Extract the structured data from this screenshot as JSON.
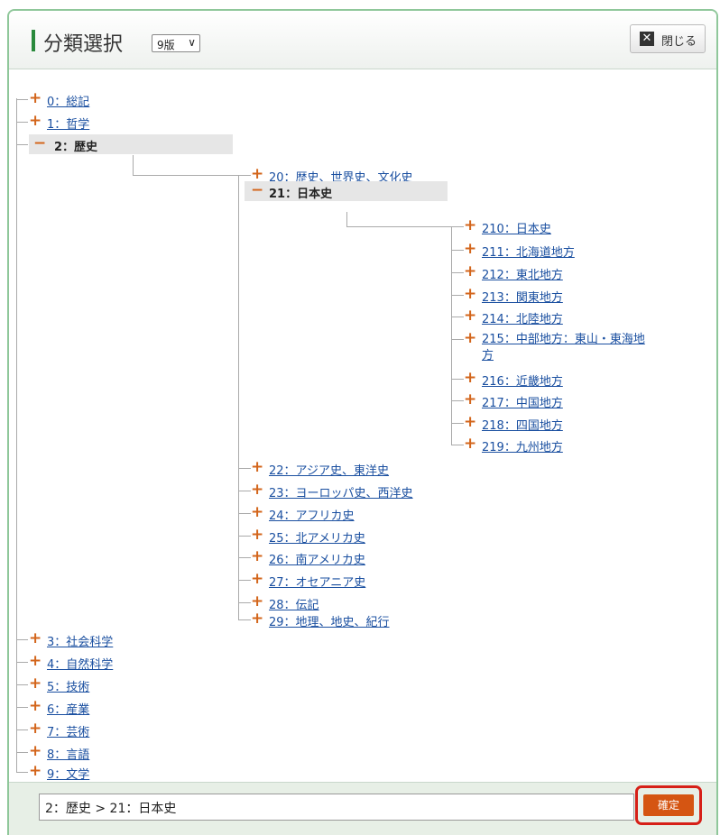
{
  "header": {
    "title": "分類選択",
    "version_select": "9版",
    "close_label": "閉じる"
  },
  "tree": {
    "n0": "0：総記",
    "n1": "1：哲学",
    "n2": "2：歴史",
    "n20": "20：歴史、世界史、文化史",
    "n21": "21：日本史",
    "n210": "210：日本史",
    "n211": "211：北海道地方",
    "n212": "212：東北地方",
    "n213": "213：関東地方",
    "n214": "214：北陸地方",
    "n215": "215：中部地方：東山・東海地方",
    "n216": "216：近畿地方",
    "n217": "217：中国地方",
    "n218": "218：四国地方",
    "n219": "219：九州地方",
    "n22": "22：アジア史、東洋史",
    "n23": "23：ヨーロッパ史、西洋史",
    "n24": "24：アフリカ史",
    "n25": "25：北アメリカ史",
    "n26": "26：南アメリカ史",
    "n27": "27：オセアニア史",
    "n28": "28：伝記",
    "n29": "29：地理、地史、紀行",
    "n3": "3：社会科学",
    "n4": "4：自然科学",
    "n5": "5：技術",
    "n6": "6：産業",
    "n7": "7：芸術",
    "n8": "8：言語",
    "n9": "9：文学",
    "expand_icon": "+",
    "collapse_icon": "−"
  },
  "footer": {
    "path_value": "2：歴史 > 21：日本史",
    "confirm_label": "確定"
  },
  "colors": {
    "accent_green": "#2a8a3c",
    "icon_orange": "#d3651b",
    "confirm_orange": "#d55512",
    "highlight_red": "#d62018",
    "link_blue": "#1a4fa0"
  }
}
